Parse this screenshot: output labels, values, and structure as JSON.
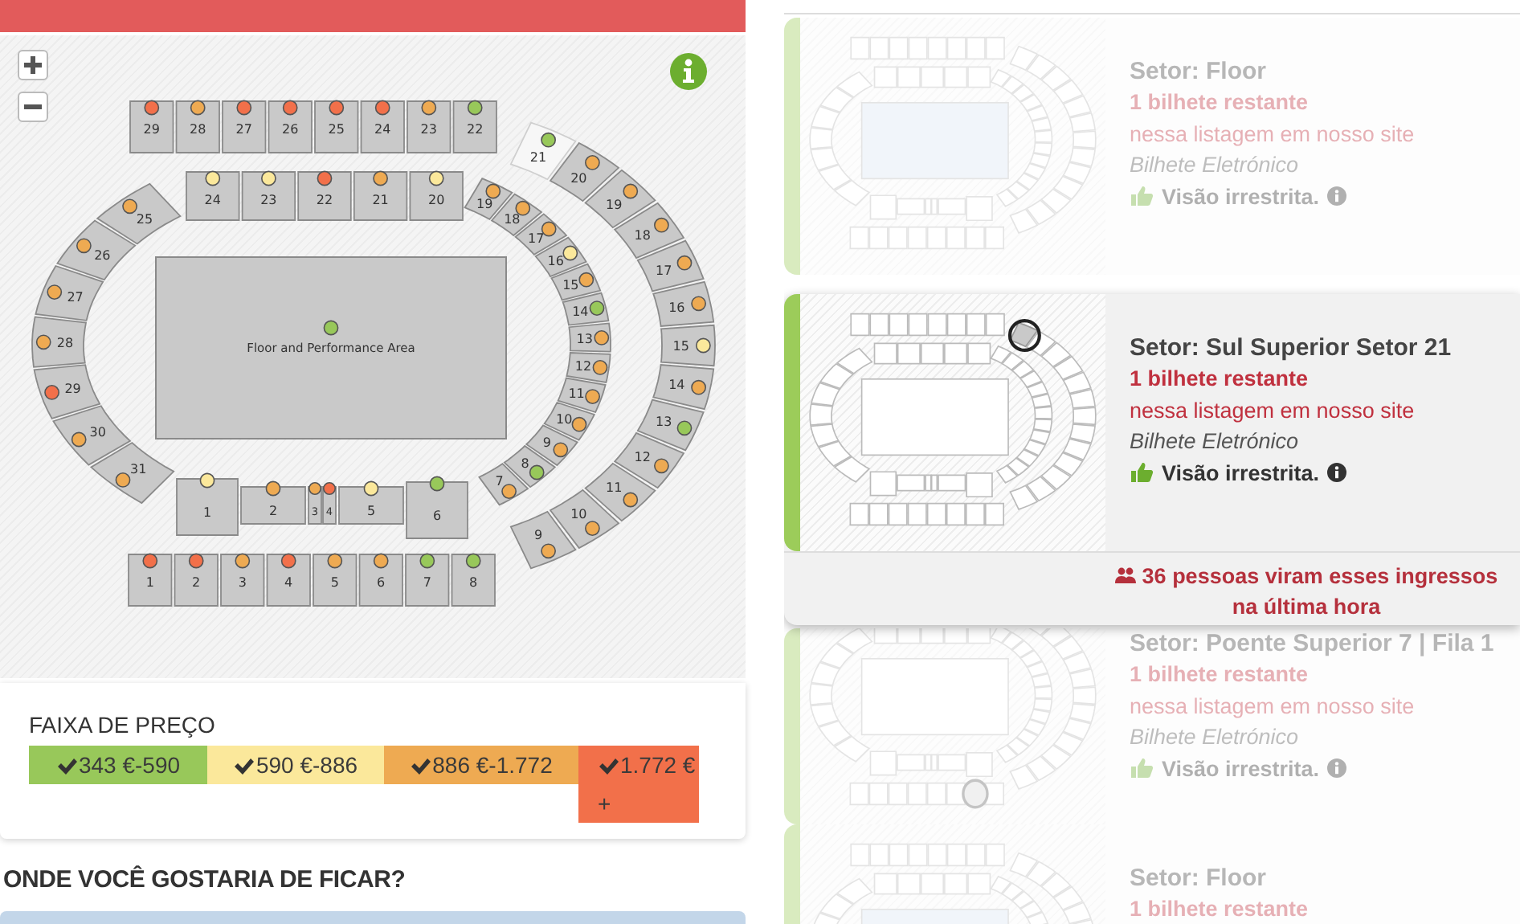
{
  "map": {
    "floor": {
      "label": "Floor and Performance Area",
      "color": "#98c85a"
    },
    "groups": [
      {
        "kind": "top_outer",
        "sections": [
          {
            "label": "29",
            "color": "#f2704a",
            "selected": false
          },
          {
            "label": "28",
            "color": "#eeaa52",
            "selected": false
          },
          {
            "label": "27",
            "color": "#f2704a",
            "selected": false
          },
          {
            "label": "26",
            "color": "#f2704a",
            "selected": false
          },
          {
            "label": "25",
            "color": "#f2704a",
            "selected": false
          },
          {
            "label": "24",
            "color": "#f2704a",
            "selected": false
          },
          {
            "label": "23",
            "color": "#eeaa52",
            "selected": false
          },
          {
            "label": "22",
            "color": "#98c85a",
            "selected": false
          }
        ]
      },
      {
        "kind": "right_outer_arc",
        "sections": [
          {
            "label": "21",
            "color": "#98c85a",
            "selected": true
          },
          {
            "label": "20",
            "color": "#eeaa52",
            "selected": false
          },
          {
            "label": "19",
            "color": "#eeaa52",
            "selected": false
          },
          {
            "label": "18",
            "color": "#eeaa52",
            "selected": false
          },
          {
            "label": "17",
            "color": "#eeaa52",
            "selected": false
          },
          {
            "label": "16",
            "color": "#eeaa52",
            "selected": false
          },
          {
            "label": "15",
            "color": "#fbe89b",
            "selected": false
          },
          {
            "label": "14",
            "color": "#eeaa52",
            "selected": false
          },
          {
            "label": "13",
            "color": "#98c85a",
            "selected": false
          },
          {
            "label": "12",
            "color": "#eeaa52",
            "selected": false
          },
          {
            "label": "11",
            "color": "#eeaa52",
            "selected": false
          },
          {
            "label": "10",
            "color": "#eeaa52",
            "selected": false
          },
          {
            "label": "9",
            "color": "#eeaa52",
            "selected": false
          }
        ]
      },
      {
        "kind": "top_inner",
        "sections": [
          {
            "label": "24",
            "color": "#fbe89b",
            "selected": false
          },
          {
            "label": "23",
            "color": "#fbe89b",
            "selected": false
          },
          {
            "label": "22",
            "color": "#f2704a",
            "selected": false
          },
          {
            "label": "21",
            "color": "#eeaa52",
            "selected": false
          },
          {
            "label": "20",
            "color": "#fbe89b",
            "selected": false
          }
        ]
      },
      {
        "kind": "left_arc",
        "sections": [
          {
            "label": "25",
            "color": "#eeaa52",
            "selected": false
          },
          {
            "label": "26",
            "color": "#eeaa52",
            "selected": false
          },
          {
            "label": "27",
            "color": "#eeaa52",
            "selected": false
          },
          {
            "label": "28",
            "color": "#eeaa52",
            "selected": false
          },
          {
            "label": "29",
            "color": "#f2704a",
            "selected": false
          },
          {
            "label": "30",
            "color": "#eeaa52",
            "selected": false
          },
          {
            "label": "31",
            "color": "#eeaa52",
            "selected": false
          }
        ]
      },
      {
        "kind": "right_inner_arc",
        "sections": [
          {
            "label": "19",
            "color": "#eeaa52",
            "selected": false
          },
          {
            "label": "18",
            "color": "#eeaa52",
            "selected": false
          },
          {
            "label": "17",
            "color": "#eeaa52",
            "selected": false
          },
          {
            "label": "16",
            "color": "#fbe89b",
            "selected": false
          },
          {
            "label": "15",
            "color": "#eeaa52",
            "selected": false
          },
          {
            "label": "14",
            "color": "#98c85a",
            "selected": false
          },
          {
            "label": "13",
            "color": "#eeaa52",
            "selected": false
          },
          {
            "label": "12",
            "color": "#eeaa52",
            "selected": false
          },
          {
            "label": "11",
            "color": "#eeaa52",
            "selected": false
          },
          {
            "label": "10",
            "color": "#eeaa52",
            "selected": false
          },
          {
            "label": "9",
            "color": "#eeaa52",
            "selected": false
          },
          {
            "label": "8",
            "color": "#98c85a",
            "selected": false
          },
          {
            "label": "7",
            "color": "#eeaa52",
            "selected": false
          }
        ]
      },
      {
        "kind": "bottom_inner",
        "sections": [
          {
            "label": "1",
            "color": "#fbe89b",
            "selected": false
          },
          {
            "label": "2",
            "color": "#eeaa52",
            "selected": false
          },
          {
            "label": "3",
            "color": "#eeaa52",
            "selected": false
          },
          {
            "label": "4",
            "color": "#f2704a",
            "selected": false
          },
          {
            "label": "5",
            "color": "#fbe89b",
            "selected": false
          },
          {
            "label": "6",
            "color": "#98c85a",
            "selected": false
          }
        ]
      },
      {
        "kind": "bottom_outer",
        "sections": [
          {
            "label": "1",
            "color": "#f2704a",
            "selected": false
          },
          {
            "label": "2",
            "color": "#f2704a",
            "selected": false
          },
          {
            "label": "3",
            "color": "#eeaa52",
            "selected": false
          },
          {
            "label": "4",
            "color": "#f2704a",
            "selected": false
          },
          {
            "label": "5",
            "color": "#eeaa52",
            "selected": false
          },
          {
            "label": "6",
            "color": "#eeaa52",
            "selected": false
          },
          {
            "label": "7",
            "color": "#98c85a",
            "selected": false
          },
          {
            "label": "8",
            "color": "#98c85a",
            "selected": false
          }
        ]
      }
    ]
  },
  "price_filter": {
    "title": "FAIXA DE PREÇO",
    "ranges": [
      {
        "label": "343 €-590",
        "color": "#98c85a",
        "checked": true
      },
      {
        "label": "590 €-886",
        "color": "#fbe89b",
        "checked": true
      },
      {
        "label": "886 €-1.772",
        "color": "#eeaa52",
        "checked": true
      },
      {
        "label": "1.772 € +",
        "color": "#f2704a",
        "checked": true
      }
    ]
  },
  "prompt": "ONDE VOCÊ GOSTARIA DE FICAR?",
  "listings": [
    {
      "featured": false,
      "kind": "floor",
      "title": "Setor: Floor",
      "remaining": "1 bilhete restante",
      "availability": "nessa listagem em nosso site",
      "delivery": "Bilhete Eletrónico",
      "view": "Visão irrestrita."
    },
    {
      "featured": true,
      "kind": "upper",
      "title": "Setor: Sul Superior Setor 21",
      "remaining": "1 bilhete restante",
      "availability": "nessa listagem em nosso site",
      "delivery": "Bilhete Eletrónico",
      "view": "Visão irrestrita.",
      "footer": "36 pessoas viram esses ingressos na última hora"
    },
    {
      "featured": false,
      "kind": "lower",
      "title": "Setor: Poente Superior 7 | Fila 1",
      "remaining": "1 bilhete restante",
      "availability": "nessa listagem em nosso site",
      "delivery": "Bilhete Eletrónico",
      "view": "Visão irrestrita."
    },
    {
      "featured": false,
      "kind": "floor",
      "title": "Setor: Floor",
      "remaining": "1 bilhete restante"
    }
  ]
}
